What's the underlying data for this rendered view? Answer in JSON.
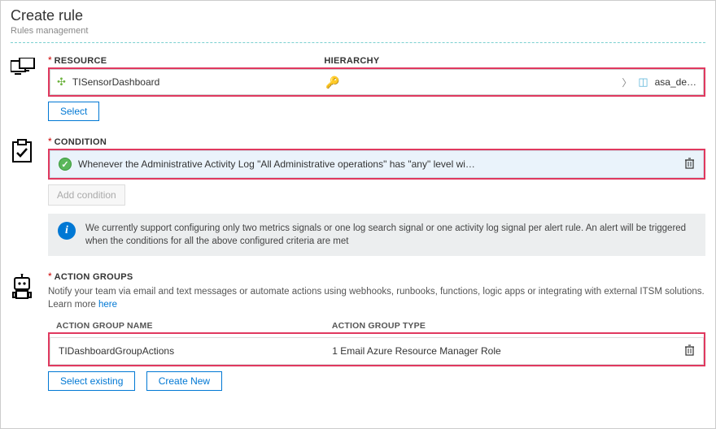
{
  "header": {
    "title": "Create rule",
    "subtitle": "Rules management"
  },
  "resource": {
    "section_label": "RESOURCE",
    "hierarchy_label": "HIERARCHY",
    "name": "TISensorDashboard",
    "parent": "asa_de…",
    "select_label": "Select"
  },
  "condition": {
    "section_label": "CONDITION",
    "text": "Whenever the Administrative Activity Log \"All Administrative operations\" has \"any\" level wi…",
    "add_label": "Add condition",
    "info_text": "We currently support configuring only two metrics signals or one log search signal or one activity log signal per alert rule. An alert will be triggered when the conditions for all the above configured criteria are met"
  },
  "action_groups": {
    "section_label": "ACTION GROUPS",
    "description": "Notify your team via email and text messages or automate actions using webhooks, runbooks, functions, logic apps or integrating with external ITSM solutions. Learn more ",
    "learn_more": "here",
    "col_name": "ACTION GROUP NAME",
    "col_type": "ACTION GROUP TYPE",
    "row_name": "TIDashboardGroupActions",
    "row_type": "1 Email Azure Resource Manager Role",
    "select_existing": "Select existing",
    "create_new": "Create New"
  }
}
